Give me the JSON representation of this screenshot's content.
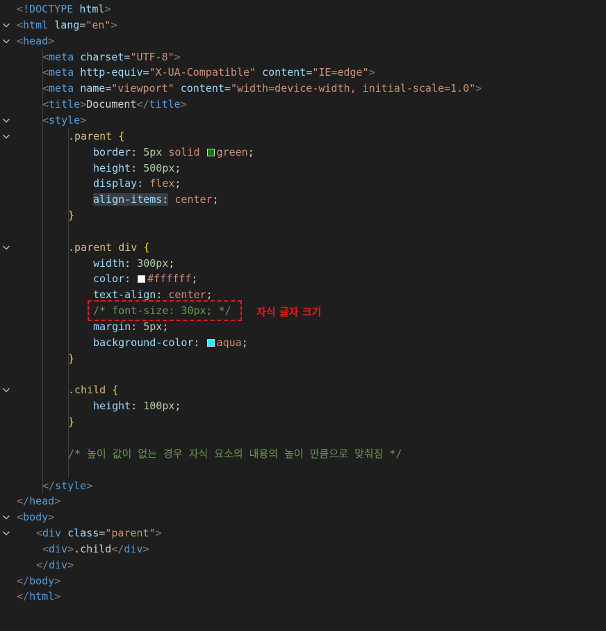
{
  "editor": {
    "lines": [
      [
        [
          "t-punc",
          "<"
        ],
        [
          "t-doctype",
          "!DOCTYPE"
        ],
        [
          "t-text",
          " "
        ],
        [
          "t-attr",
          "html"
        ],
        [
          "t-punc",
          ">"
        ]
      ],
      [
        [
          "t-punc",
          "<"
        ],
        [
          "t-tag",
          "html"
        ],
        [
          "t-text",
          " "
        ],
        [
          "t-attr",
          "lang"
        ],
        [
          "t-text",
          "="
        ],
        [
          "t-str",
          "\"en\""
        ],
        [
          "t-punc",
          ">"
        ]
      ],
      [
        [
          "t-punc",
          "<"
        ],
        [
          "t-tag",
          "head"
        ],
        [
          "t-punc",
          ">"
        ]
      ],
      [
        [
          "t-punc",
          "<"
        ],
        [
          "t-tag",
          "meta"
        ],
        [
          "t-text",
          " "
        ],
        [
          "t-attr",
          "charset"
        ],
        [
          "t-text",
          "="
        ],
        [
          "t-str",
          "\"UTF-8\""
        ],
        [
          "t-punc",
          ">"
        ]
      ],
      [
        [
          "t-punc",
          "<"
        ],
        [
          "t-tag",
          "meta"
        ],
        [
          "t-text",
          " "
        ],
        [
          "t-attr",
          "http-equiv"
        ],
        [
          "t-text",
          "="
        ],
        [
          "t-str",
          "\"X-UA-Compatible\""
        ],
        [
          "t-text",
          " "
        ],
        [
          "t-attr",
          "content"
        ],
        [
          "t-text",
          "="
        ],
        [
          "t-str",
          "\"IE=edge\""
        ],
        [
          "t-punc",
          ">"
        ]
      ],
      [
        [
          "t-punc",
          "<"
        ],
        [
          "t-tag",
          "meta"
        ],
        [
          "t-text",
          " "
        ],
        [
          "t-attr",
          "name"
        ],
        [
          "t-text",
          "="
        ],
        [
          "t-str",
          "\"viewport\""
        ],
        [
          "t-text",
          " "
        ],
        [
          "t-attr",
          "content"
        ],
        [
          "t-text",
          "="
        ],
        [
          "t-str",
          "\"width=device-width, initial-scale=1.0\""
        ],
        [
          "t-punc",
          ">"
        ]
      ],
      [
        [
          "t-punc",
          "<"
        ],
        [
          "t-tag",
          "title"
        ],
        [
          "t-punc",
          ">"
        ],
        [
          "t-text",
          "Document"
        ],
        [
          "t-punc",
          "</"
        ],
        [
          "t-tag",
          "title"
        ],
        [
          "t-punc",
          ">"
        ]
      ],
      [
        [
          "t-punc",
          "<"
        ],
        [
          "t-tag",
          "style"
        ],
        [
          "t-punc",
          ">"
        ]
      ],
      [
        [
          "t-sel",
          ".parent"
        ],
        [
          "t-text",
          " "
        ],
        [
          "t-brace",
          "{"
        ]
      ],
      [
        [
          "t-prop",
          "border"
        ],
        [
          "t-text",
          ": "
        ],
        [
          "t-num",
          "5px"
        ],
        [
          "t-text",
          " "
        ],
        [
          "t-val",
          "solid"
        ],
        [
          "t-text",
          " "
        ],
        [
          "swatch",
          "#008000"
        ],
        [
          "t-val",
          "green"
        ],
        [
          "t-text",
          ";"
        ]
      ],
      [
        [
          "t-prop",
          "height"
        ],
        [
          "t-text",
          ": "
        ],
        [
          "t-num",
          "500px"
        ],
        [
          "t-text",
          ";"
        ]
      ],
      [
        [
          "t-prop",
          "display"
        ],
        [
          "t-text",
          ": "
        ],
        [
          "t-val",
          "flex"
        ],
        [
          "t-text",
          ";"
        ]
      ],
      [
        [
          "hl-prop",
          "align-items"
        ],
        [
          "hl-text",
          ":"
        ],
        [
          "t-text",
          " "
        ],
        [
          "t-val",
          "center"
        ],
        [
          "t-text",
          ";"
        ]
      ],
      [
        [
          "t-brace",
          "}"
        ]
      ],
      [],
      [
        [
          "t-sel",
          ".parent"
        ],
        [
          "t-text",
          " "
        ],
        [
          "t-sel",
          "div"
        ],
        [
          "t-text",
          " "
        ],
        [
          "t-brace",
          "{"
        ]
      ],
      [
        [
          "t-prop",
          "width"
        ],
        [
          "t-text",
          ": "
        ],
        [
          "t-num",
          "300px"
        ],
        [
          "t-text",
          ";"
        ]
      ],
      [
        [
          "t-prop",
          "color"
        ],
        [
          "t-text",
          ": "
        ],
        [
          "swatch",
          "#ffffff"
        ],
        [
          "t-val",
          "#ffffff"
        ],
        [
          "t-text",
          ";"
        ]
      ],
      [
        [
          "t-prop",
          "text-align"
        ],
        [
          "t-text",
          ": "
        ],
        [
          "t-val",
          "center"
        ],
        [
          "t-text",
          ";"
        ]
      ],
      [
        [
          "t-com",
          "/* font-size: 30px; */"
        ]
      ],
      [
        [
          "t-prop",
          "margin"
        ],
        [
          "t-text",
          ": "
        ],
        [
          "t-num",
          "5px"
        ],
        [
          "t-text",
          ";"
        ]
      ],
      [
        [
          "t-prop",
          "background-color"
        ],
        [
          "t-text",
          ": "
        ],
        [
          "swatch",
          "#00ffff"
        ],
        [
          "t-val",
          "aqua"
        ],
        [
          "t-text",
          ";"
        ]
      ],
      [
        [
          "t-brace",
          "}"
        ]
      ],
      [],
      [
        [
          "t-sel",
          ".child"
        ],
        [
          "t-text",
          " "
        ],
        [
          "t-brace",
          "{"
        ]
      ],
      [
        [
          "t-prop",
          "height"
        ],
        [
          "t-text",
          ": "
        ],
        [
          "t-num",
          "100px"
        ],
        [
          "t-text",
          ";"
        ]
      ],
      [
        [
          "t-brace",
          "}"
        ]
      ],
      [],
      [
        [
          "t-com",
          "/* 높이 값이 없는 경우 자식 요소의 내용의 높이 만큼으로 맞춰짐 */"
        ]
      ],
      [],
      [
        [
          "t-punc",
          "</"
        ],
        [
          "t-tag",
          "style"
        ],
        [
          "t-punc",
          ">"
        ]
      ],
      [
        [
          "t-punc",
          "</"
        ],
        [
          "t-tag",
          "head"
        ],
        [
          "t-punc",
          ">"
        ]
      ],
      [
        [
          "t-punc",
          "<"
        ],
        [
          "t-tag",
          "body"
        ],
        [
          "t-punc",
          ">"
        ]
      ],
      [
        [
          "t-punc",
          "<"
        ],
        [
          "t-tag",
          "div"
        ],
        [
          "t-text",
          " "
        ],
        [
          "t-attr",
          "class"
        ],
        [
          "t-text",
          "="
        ],
        [
          "t-str",
          "\"parent\""
        ],
        [
          "t-punc",
          ">"
        ]
      ],
      [
        [
          "t-punc",
          "<"
        ],
        [
          "t-tag",
          "div"
        ],
        [
          "t-punc",
          ">"
        ],
        [
          "t-text",
          ".child"
        ],
        [
          "t-punc",
          "</"
        ],
        [
          "t-tag",
          "div"
        ],
        [
          "t-punc",
          ">"
        ]
      ],
      [
        [
          "t-punc",
          "</"
        ],
        [
          "t-tag",
          "div"
        ],
        [
          "t-punc",
          ">"
        ]
      ],
      [
        [
          "t-punc",
          "</"
        ],
        [
          "t-tag",
          "body"
        ],
        [
          "t-punc",
          ">"
        ]
      ],
      [
        [
          "t-punc",
          "</"
        ],
        [
          "t-tag",
          "html"
        ],
        [
          "t-punc",
          ">"
        ]
      ]
    ]
  },
  "annotation": {
    "label": "자식 글자 크기",
    "color": "#e81818"
  },
  "colors": {
    "background": "#1e1e1e"
  }
}
